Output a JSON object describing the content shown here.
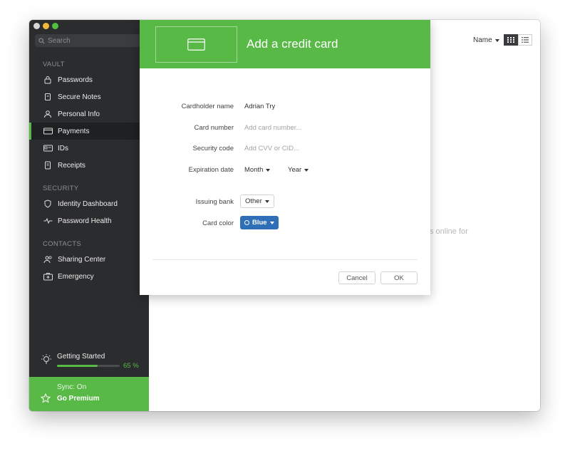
{
  "colors": {
    "accent_green": "#58b947",
    "sidebar_bg": "#2b2c2e",
    "blue_select": "#2f6fb8"
  },
  "sidebar": {
    "search_placeholder": "Search",
    "sections": {
      "vault": "VAULT",
      "security": "SECURITY",
      "contacts": "CONTACTS"
    },
    "items": [
      {
        "label": "Passwords",
        "icon": "lock-icon"
      },
      {
        "label": "Secure Notes",
        "icon": "note-icon"
      },
      {
        "label": "Personal Info",
        "icon": "person-icon"
      },
      {
        "label": "Payments",
        "icon": "credit-card-icon",
        "active": true
      },
      {
        "label": "IDs",
        "icon": "id-card-icon"
      },
      {
        "label": "Receipts",
        "icon": "receipt-icon"
      },
      {
        "label": "Identity Dashboard",
        "icon": "shield-icon"
      },
      {
        "label": "Password Health",
        "icon": "pulse-icon"
      },
      {
        "label": "Sharing Center",
        "icon": "people-icon"
      },
      {
        "label": "Emergency",
        "icon": "first-aid-icon"
      }
    ],
    "getting_started": {
      "label": "Getting Started",
      "percent_text": "65 %",
      "progress": 0.65
    },
    "premium": {
      "sync": "Sync: On",
      "go_premium": "Go Premium"
    }
  },
  "main": {
    "sort_label": "Name",
    "background_text": "s online for"
  },
  "modal": {
    "title": "Add a credit card",
    "fields": {
      "cardholder_label": "Cardholder name",
      "cardholder_value": "Adrian Try",
      "card_number_label": "Card number",
      "card_number_placeholder": "Add card number...",
      "security_code_label": "Security code",
      "security_code_placeholder": "Add CVV or CID...",
      "expiration_label": "Expiration date",
      "month": "Month",
      "year": "Year",
      "issuing_bank_label": "Issuing bank",
      "issuing_bank_value": "Other",
      "card_color_label": "Card color",
      "card_color_value": "Blue"
    },
    "buttons": {
      "cancel": "Cancel",
      "ok": "OK"
    }
  }
}
